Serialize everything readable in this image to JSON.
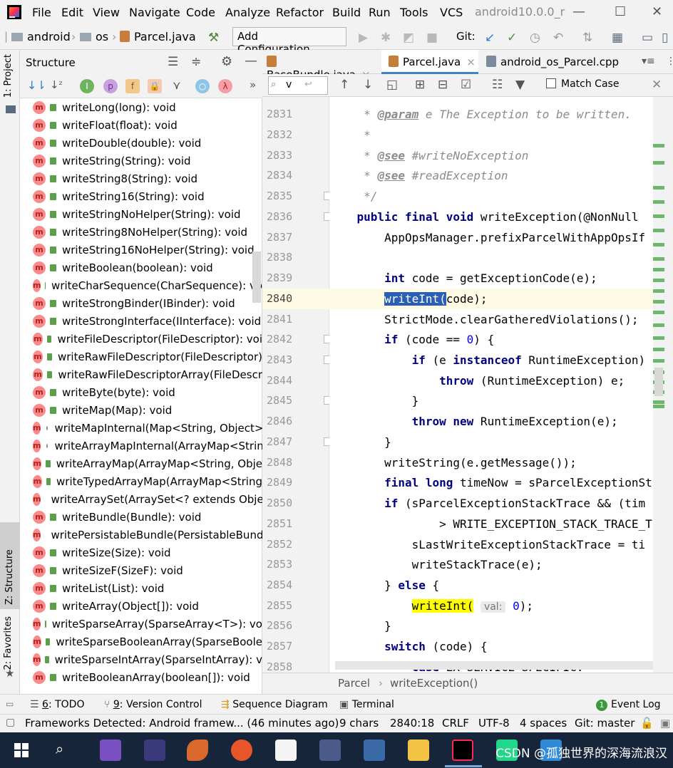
{
  "menubar": {
    "items": [
      "File",
      "Edit",
      "View",
      "Navigate",
      "Code",
      "Analyze",
      "Refactor",
      "Build",
      "Run",
      "Tools",
      "VCS"
    ],
    "window_title": "android10.0.0_r"
  },
  "navbar": {
    "crumbs": [
      "android",
      "os",
      "Parcel.java"
    ],
    "add_configuration": "Add Configuration...",
    "git_label": "Git:"
  },
  "side_tabs": {
    "project": "1: Project",
    "structure": "Z: Structure",
    "favorites": "2: Favorites"
  },
  "structure": {
    "title": "Structure",
    "items": [
      {
        "label": "writeLong(long): void",
        "icon": "method-icon",
        "access": "public"
      },
      {
        "label": "writeFloat(float): void",
        "icon": "method-icon",
        "access": "public"
      },
      {
        "label": "writeDouble(double): void",
        "icon": "method-icon",
        "access": "public"
      },
      {
        "label": "writeString(String): void",
        "icon": "method-icon",
        "access": "public"
      },
      {
        "label": "writeString8(String): void",
        "icon": "method-icon",
        "access": "public"
      },
      {
        "label": "writeString16(String): void",
        "icon": "method-icon",
        "access": "public"
      },
      {
        "label": "writeStringNoHelper(String): void",
        "icon": "method-icon",
        "access": "public"
      },
      {
        "label": "writeString8NoHelper(String): void",
        "icon": "method-icon",
        "access": "public"
      },
      {
        "label": "writeString16NoHelper(String): void",
        "icon": "method-icon",
        "access": "public"
      },
      {
        "label": "writeBoolean(boolean): void",
        "icon": "method-icon",
        "access": "public"
      },
      {
        "label": "writeCharSequence(CharSequence): vo",
        "icon": "method-icon",
        "access": "public"
      },
      {
        "label": "writeStrongBinder(IBinder): void",
        "icon": "method-icon",
        "access": "public"
      },
      {
        "label": "writeStrongInterface(IInterface): void",
        "icon": "method-icon",
        "access": "public"
      },
      {
        "label": "writeFileDescriptor(FileDescriptor): voi",
        "icon": "method-icon",
        "access": "public"
      },
      {
        "label": "writeRawFileDescriptor(FileDescriptor)",
        "icon": "method-icon",
        "access": "public"
      },
      {
        "label": "writeRawFileDescriptorArray(FileDescr",
        "icon": "method-icon",
        "access": "public"
      },
      {
        "label": "writeByte(byte): void",
        "icon": "method-icon",
        "access": "public"
      },
      {
        "label": "writeMap(Map): void",
        "icon": "method-icon",
        "access": "public"
      },
      {
        "label": "writeMapInternal(Map<String, Object>",
        "icon": "method-icon",
        "access": "package"
      },
      {
        "label": "writeArrayMapInternal(ArrayMap<Strin",
        "icon": "method-icon",
        "access": "package"
      },
      {
        "label": "writeArrayMap(ArrayMap<String, Obje",
        "icon": "method-icon",
        "access": "public"
      },
      {
        "label": "writeTypedArrayMap(ArrayMap<String",
        "icon": "method-icon",
        "access": "public"
      },
      {
        "label": "writeArraySet(ArraySet<? extends Obje",
        "icon": "method-icon",
        "access": "public"
      },
      {
        "label": "writeBundle(Bundle): void",
        "icon": "method-icon",
        "access": "public"
      },
      {
        "label": "writePersistableBundle(PersistableBund",
        "icon": "method-icon",
        "access": "public"
      },
      {
        "label": "writeSize(Size): void",
        "icon": "method-icon",
        "access": "public"
      },
      {
        "label": "writeSizeF(SizeF): void",
        "icon": "method-icon",
        "access": "public"
      },
      {
        "label": "writeList(List): void",
        "icon": "method-icon",
        "access": "public"
      },
      {
        "label": "writeArray(Object[]): void",
        "icon": "method-icon",
        "access": "public"
      },
      {
        "label": "writeSparseArray(SparseArray<T>): vo",
        "icon": "method-icon",
        "access": "public"
      },
      {
        "label": "writeSparseBooleanArray(SparseBoole",
        "icon": "method-icon",
        "access": "public"
      },
      {
        "label": "writeSparseIntArray(SparseIntArray): v",
        "icon": "method-icon",
        "access": "public"
      },
      {
        "label": "writeBooleanArray(boolean[]): void",
        "icon": "method-icon",
        "access": "public"
      }
    ]
  },
  "tabs": [
    {
      "label": "BaseBundle.java",
      "active": false
    },
    {
      "label": "Parcel.java",
      "active": true
    },
    {
      "label": "android_os_Parcel.cpp",
      "active": false
    }
  ],
  "findbar": {
    "query": "v",
    "match_case": "Match Case"
  },
  "editor": {
    "line_numbers": [
      "2831",
      "2832",
      "2833",
      "2834",
      "2835",
      "2836",
      "2837",
      "2838",
      "2839",
      "2840",
      "2841",
      "2842",
      "2843",
      "2844",
      "2845",
      "2846",
      "2847",
      "2848",
      "2849",
      "2850",
      "2851",
      "2852",
      "2853",
      "2854",
      "2855",
      "2856",
      "2857",
      "2858"
    ],
    "current_line": "2840",
    "code": {
      "l2831_tag": "@param",
      "l2831_rest": " e The Exception to be written.",
      "l2832": "     *",
      "l2833_tag": "@see",
      "l2833_rest": " #writeNoException",
      "l2834_tag": "@see",
      "l2834_rest": " #readException",
      "l2835": "     */",
      "l2836_kw": "public final void",
      "l2836_rest": " writeException(@NonNull ",
      "l2837": "        AppOpsManager.prefixParcelWithAppOpsIf",
      "l2839_kw": "int",
      "l2839_rest": " code = getExceptionCode(e);",
      "l2840_sel": "writeInt(",
      "l2840_rest": "code);",
      "l2841": "        StrictMode.clearGatheredViolations();",
      "l2842_kw": "if",
      "l2842_rest": " (code == ",
      "l2842_num": "0",
      "l2842_end": ") {",
      "l2843_kw1": "if",
      "l2843_mid": " (e ",
      "l2843_kw2": "instanceof",
      "l2843_rest": " RuntimeException)",
      "l2844_kw": "throw",
      "l2844_rest": " (RuntimeException) e;",
      "l2845": "            }",
      "l2846_kw": "throw new",
      "l2846_rest": " RuntimeException(e);",
      "l2847": "        }",
      "l2848": "        writeString(e.getMessage());",
      "l2849_kw": "final long",
      "l2849_rest": " timeNow = sParcelExceptionSt",
      "l2850_kw": "if",
      "l2850_rest": " (sParcelExceptionStackTrace && (tim",
      "l2851": "                > WRITE_EXCEPTION_STACK_TRACE_T",
      "l2852": "            sLastWriteExceptionStackTrace = ti",
      "l2853": "            writeStackTrace(e);",
      "l2854_a": "        } ",
      "l2854_kw": "else",
      "l2854_b": " {",
      "l2855_hl": "writeInt(",
      "l2855_hint": "val:",
      "l2855_num": "0",
      "l2855_end": ");",
      "l2856": "        }",
      "l2857_kw": "switch",
      "l2857_rest": " (code) {",
      "l2858_kw": "case",
      "l2858_rest": " EX_SERVICE_SPECIFIC:"
    }
  },
  "breadcrumbs": {
    "class": "Parcel",
    "method": "writeException()",
    "sep": "›"
  },
  "toolwindows": {
    "todo_num": "6",
    "todo": ": TODO",
    "vc_num": "9",
    "vc": ": Version Control",
    "seq": "Sequence Diagram",
    "terminal": "Terminal",
    "eventlog": "Event Log",
    "eventlog_badge": "1"
  },
  "status": {
    "message": "Frameworks Detected: Android framew... (46 minutes ago)",
    "chars": "9 chars",
    "position": "2840:18",
    "line_sep": "CRLF",
    "encoding": "UTF-8",
    "indent": "4 spaces",
    "git": "Git: master"
  },
  "taskbar": {
    "watermark": "CSDN @孤独世界的深海流浪汉"
  },
  "colors": {
    "accent": "#4083c9",
    "keyword": "#000080",
    "number": "#0000ff",
    "highlight": "#ffff00",
    "selection": "#2b5fb5"
  }
}
